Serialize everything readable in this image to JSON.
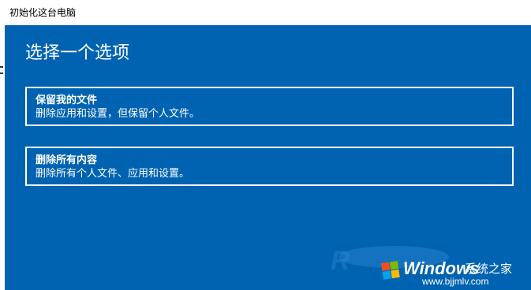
{
  "window": {
    "title": "初始化这台电脑"
  },
  "main": {
    "heading": "选择一个选项",
    "options": [
      {
        "title": "保留我的文件",
        "description": "删除应用和设置，但保留个人文件。"
      },
      {
        "title": "删除所有内容",
        "description": "删除所有个人文件、应用和设置。"
      }
    ]
  },
  "watermark": {
    "brand": "Windows",
    "brand_cn": "系统之家",
    "url": "www.bjjmlv.com"
  },
  "colors": {
    "panel_bg": "#0063b1",
    "text": "#ffffff"
  }
}
